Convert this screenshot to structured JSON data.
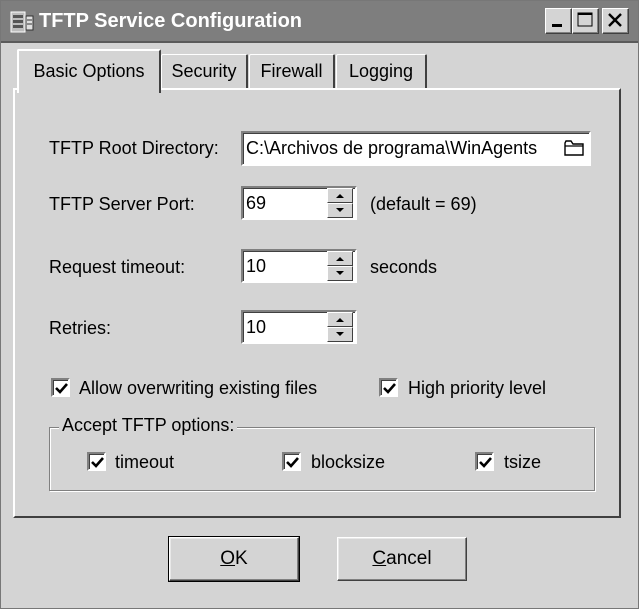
{
  "window": {
    "title": "TFTP Service Configuration"
  },
  "tabs": [
    {
      "label": "Basic Options",
      "active": true
    },
    {
      "label": "Security",
      "active": false
    },
    {
      "label": "Firewall",
      "active": false
    },
    {
      "label": "Logging",
      "active": false
    }
  ],
  "root_dir": {
    "label": "TFTP Root Directory:",
    "value": "C:\\Archivos de programa\\WinAgents"
  },
  "server_port": {
    "label": "TFTP Server Port:",
    "value": "69",
    "hint": "(default = 69)"
  },
  "timeout": {
    "label": "Request timeout:",
    "value": "10",
    "unit": "seconds"
  },
  "retries": {
    "label": "Retries:",
    "value": "10"
  },
  "options": {
    "allow_overwrite": {
      "label": "Allow overwriting existing files",
      "checked": true
    },
    "high_priority": {
      "label": "High priority level",
      "checked": true
    }
  },
  "accept_group": {
    "legend": "Accept TFTP options:",
    "items": [
      {
        "label": "timeout",
        "checked": true
      },
      {
        "label": "blocksize",
        "checked": true
      },
      {
        "label": "tsize",
        "checked": true
      }
    ]
  },
  "buttons": {
    "ok": {
      "mnemonic": "O",
      "rest": "K"
    },
    "cancel": {
      "mnemonic": "C",
      "rest": "ancel"
    }
  }
}
